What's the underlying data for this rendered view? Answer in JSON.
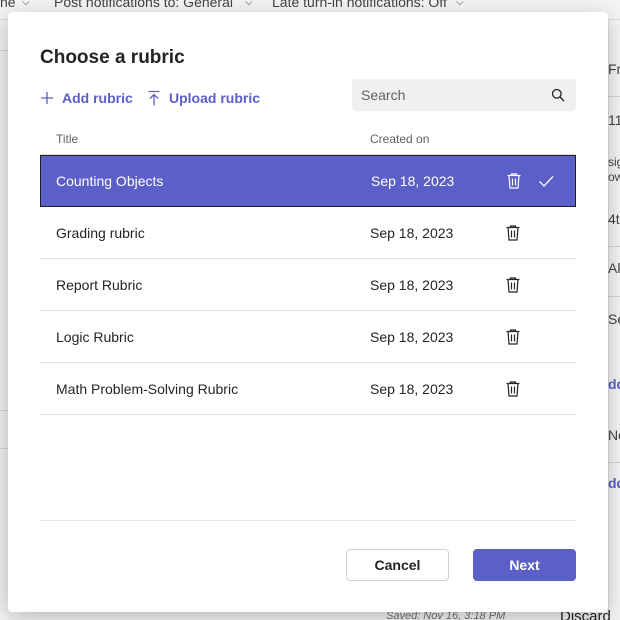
{
  "background": {
    "topbar": {
      "item_1_fragment": "ne",
      "item_2": "Post notifications to: General",
      "item_3": "Late turn-in notifications: Off"
    },
    "right_fragments": [
      "Fr",
      "11",
      "sig",
      "ow",
      "4t",
      "All",
      "Se",
      "dd",
      "No",
      "dd"
    ],
    "saved_text": "Saved: Nov 16, 3:18 PM",
    "discard_label": "Discard"
  },
  "modal": {
    "title": "Choose a rubric",
    "add_label": "Add rubric",
    "upload_label": "Upload rubric",
    "search": {
      "placeholder": "Search",
      "value": ""
    },
    "columns": {
      "title": "Title",
      "created": "Created on"
    },
    "rows": [
      {
        "title": "Counting Objects",
        "created": "Sep 18, 2023",
        "selected": true
      },
      {
        "title": "Grading rubric",
        "created": "Sep 18, 2023",
        "selected": false
      },
      {
        "title": "Report Rubric",
        "created": "Sep 18, 2023",
        "selected": false
      },
      {
        "title": "Logic Rubric",
        "created": "Sep 18, 2023",
        "selected": false
      },
      {
        "title": "Math Problem-Solving Rubric",
        "created": "Sep 18, 2023",
        "selected": false
      }
    ],
    "cancel_label": "Cancel",
    "next_label": "Next"
  },
  "icons": {
    "add": "plus-icon",
    "upload": "upload-arrow-icon",
    "search": "search-icon",
    "delete": "trash-icon",
    "selected": "checkmark-icon",
    "dropdown": "chevron-down-icon"
  },
  "colors": {
    "accent": "#5b5fc7",
    "selected_row_text": "#ffffff",
    "text": "#242424",
    "muted": "#616161"
  }
}
